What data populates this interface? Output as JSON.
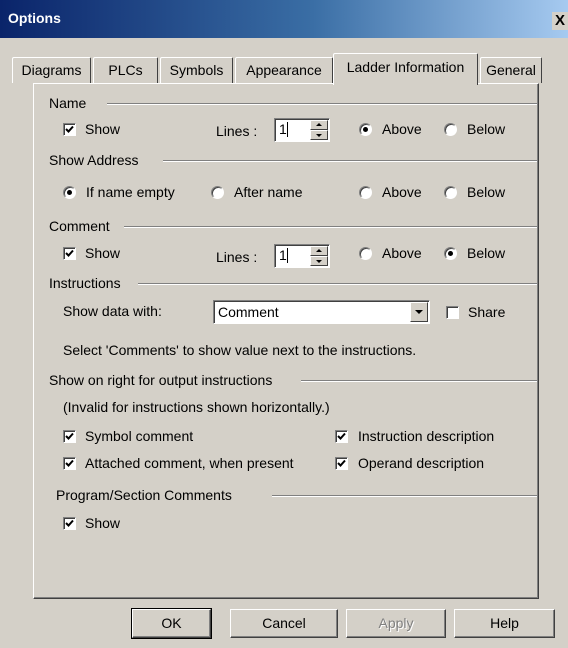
{
  "window": {
    "title": "Options",
    "close_glyph": "X"
  },
  "tabs": [
    "Diagrams",
    "PLCs",
    "Symbols",
    "Appearance",
    "Ladder Information",
    "General"
  ],
  "active_tab": "Ladder Information",
  "name_group": {
    "label": "Name",
    "show_label": "Show",
    "show_checked": true,
    "lines_label": "Lines :",
    "lines_value": "1",
    "above_label": "Above",
    "below_label": "Below",
    "position": "Above"
  },
  "address_group": {
    "label": "Show Address",
    "if_name_empty_label": "If name empty",
    "after_name_label": "After name",
    "above_label": "Above",
    "below_label": "Below",
    "selected": "If name empty"
  },
  "comment_group": {
    "label": "Comment",
    "show_label": "Show",
    "show_checked": true,
    "lines_label": "Lines :",
    "lines_value": "1",
    "above_label": "Above",
    "below_label": "Below",
    "position": "Below"
  },
  "instructions_group": {
    "label": "Instructions",
    "show_data_label": "Show data with:",
    "combo_value": "Comment",
    "share_label": "Share",
    "share_checked": false,
    "hint": "Select 'Comments' to show value next to the instructions."
  },
  "output_group": {
    "label": "Show on right for output instructions",
    "note": "(Invalid for instructions shown horizontally.)",
    "symbol_comment_label": "Symbol comment",
    "attached_comment_label": "Attached comment, when present",
    "instruction_desc_label": "Instruction description",
    "operand_desc_label": "Operand description"
  },
  "program_group": {
    "label": "Program/Section Comments",
    "show_label": "Show"
  },
  "buttons": {
    "ok": "OK",
    "cancel": "Cancel",
    "apply": "Apply",
    "help": "Help"
  }
}
